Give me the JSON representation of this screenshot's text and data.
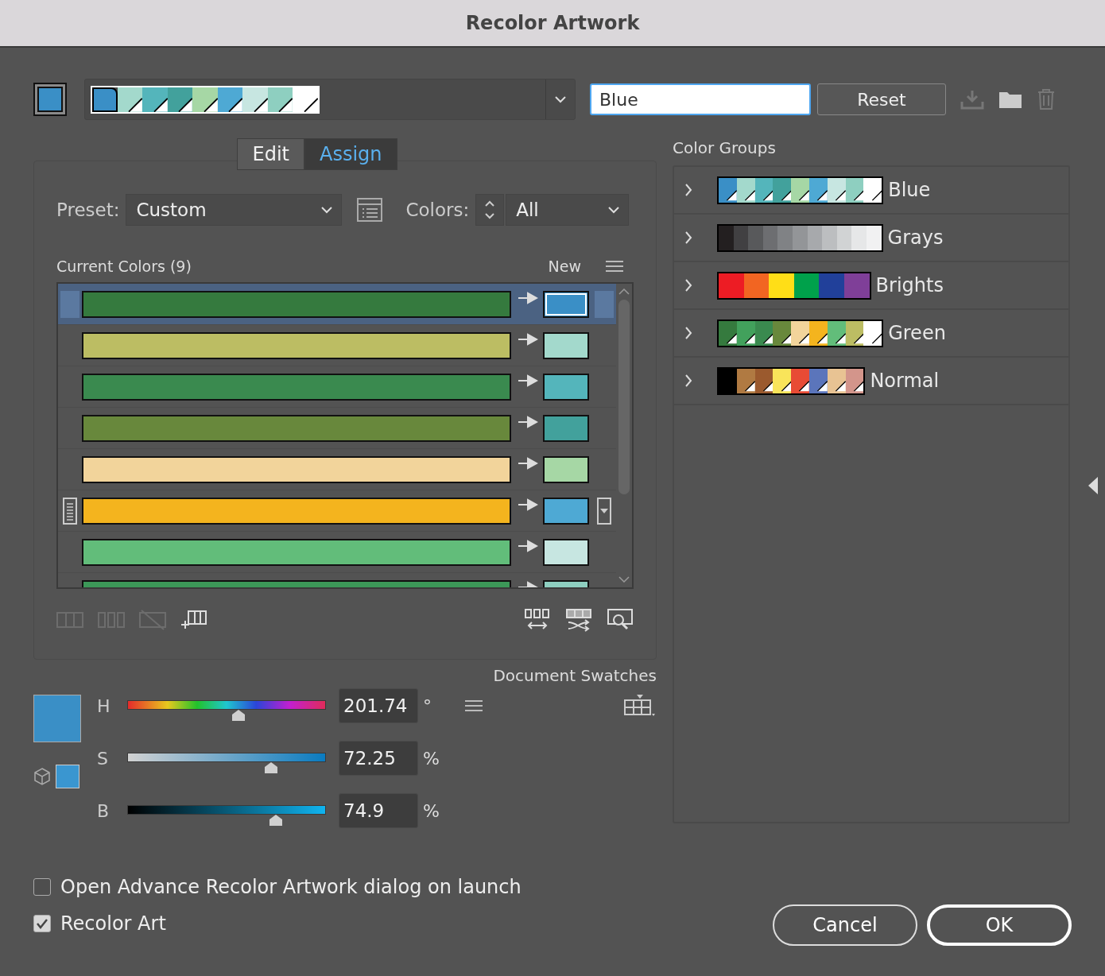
{
  "window": {
    "title": "Recolor Artwork"
  },
  "active_color": {
    "color": "#3a8fc6"
  },
  "group_strip": [
    {
      "color": "#3a8fc6",
      "global": false,
      "selected": true
    },
    {
      "color": "#a3d9cc",
      "global": true,
      "selected": false
    },
    {
      "color": "#54b5bb",
      "global": true,
      "selected": false
    },
    {
      "color": "#42a19c",
      "global": true,
      "selected": false
    },
    {
      "color": "#a6d7a5",
      "global": true,
      "selected": false
    },
    {
      "color": "#4ea9d4",
      "global": true,
      "selected": false
    },
    {
      "color": "#c7e6e1",
      "global": true,
      "selected": false
    },
    {
      "color": "#8ecfc0",
      "global": true,
      "selected": false
    },
    {
      "color": "#ffffff",
      "global": true,
      "selected": false
    }
  ],
  "name_field": {
    "value": "Blue"
  },
  "reset_button": "Reset",
  "tabs": [
    {
      "label": "Edit",
      "selected": false
    },
    {
      "label": "Assign",
      "selected": true
    }
  ],
  "preset": {
    "label": "Preset:",
    "value": "Custom"
  },
  "colors": {
    "label": "Colors:",
    "value": "All"
  },
  "current_colors": {
    "title": "Current Colors (9)",
    "new_label": "New",
    "rows": [
      {
        "current": {
          "color": "#357a3e"
        },
        "new": {
          "color": "#3a8fc6"
        },
        "selected": true,
        "hovered": false
      },
      {
        "current": {
          "color": "#bcbd63"
        },
        "new": {
          "color": "#a3d9cc"
        },
        "selected": false,
        "hovered": false
      },
      {
        "current": {
          "color": "#3a8a4f"
        },
        "new": {
          "color": "#54b5bb"
        },
        "selected": false,
        "hovered": false
      },
      {
        "current": {
          "color": "#68883c"
        },
        "new": {
          "color": "#42a19c"
        },
        "selected": false,
        "hovered": false
      },
      {
        "current": {
          "color": "#f2d49b"
        },
        "new": {
          "color": "#a6d7a5"
        },
        "selected": false,
        "hovered": false
      },
      {
        "current": {
          "color": "#f4b41e"
        },
        "new": {
          "color": "#4ea9d4"
        },
        "selected": false,
        "hovered": true
      },
      {
        "current": {
          "color": "#62bd7a"
        },
        "new": {
          "color": "#c7e6e1"
        },
        "selected": false,
        "hovered": false
      },
      {
        "current": {
          "color": "#3c9858"
        },
        "new": {
          "color": "#8ecfc0"
        },
        "selected": false,
        "hovered": false
      }
    ]
  },
  "document_swatches": "Document Swatches",
  "editor_color": {
    "color": "#3a8fc6"
  },
  "sliders": [
    {
      "kind": "hue",
      "label": "H",
      "level": 0.5604,
      "reading": "201.74",
      "unit": "°"
    },
    {
      "kind": "saturation",
      "label": "S",
      "level": 0.7225,
      "reading": "72.25",
      "unit": "%"
    },
    {
      "kind": "brightness",
      "label": "B",
      "level": 0.749,
      "reading": "74.9",
      "unit": "%"
    }
  ],
  "color_groups": {
    "title": "Color Groups",
    "groups": [
      {
        "name": "Blue",
        "expanded": false,
        "swatches": [
          {
            "color": "#3a8fc6",
            "global": true
          },
          {
            "color": "#a3d9cc",
            "global": true
          },
          {
            "color": "#54b5bb",
            "global": true
          },
          {
            "color": "#42a19c",
            "global": true
          },
          {
            "color": "#a6d7a5",
            "global": true
          },
          {
            "color": "#4ea9d4",
            "global": true
          },
          {
            "color": "#c7e6e1",
            "global": true
          },
          {
            "color": "#8ecfc0",
            "global": true
          },
          {
            "color": "#ffffff",
            "global": true
          }
        ]
      },
      {
        "name": "Grays",
        "expanded": false,
        "swatches": [
          {
            "color": "#231f20",
            "global": false
          },
          {
            "color": "#414042",
            "global": false
          },
          {
            "color": "#58595b",
            "global": false
          },
          {
            "color": "#6d6e71",
            "global": false
          },
          {
            "color": "#808285",
            "global": false
          },
          {
            "color": "#939598",
            "global": false
          },
          {
            "color": "#a7a9ac",
            "global": false
          },
          {
            "color": "#bcbec0",
            "global": false
          },
          {
            "color": "#d1d3d4",
            "global": false
          },
          {
            "color": "#e6e7e8",
            "global": false
          },
          {
            "color": "#f1f1f2",
            "global": false
          }
        ]
      },
      {
        "name": "Brights",
        "expanded": false,
        "swatches": [
          {
            "color": "#ed1c24",
            "global": false
          },
          {
            "color": "#f26522",
            "global": false
          },
          {
            "color": "#ffde17",
            "global": false
          },
          {
            "color": "#00a14b",
            "global": false
          },
          {
            "color": "#21409a",
            "global": false
          },
          {
            "color": "#7f3f98",
            "global": false
          }
        ]
      },
      {
        "name": "Green",
        "expanded": false,
        "swatches": [
          {
            "color": "#357a3e",
            "global": true
          },
          {
            "color": "#42a15c",
            "global": true
          },
          {
            "color": "#3a8a4f",
            "global": true
          },
          {
            "color": "#68883c",
            "global": true
          },
          {
            "color": "#f2d49b",
            "global": true
          },
          {
            "color": "#f4b41e",
            "global": true
          },
          {
            "color": "#62bd7a",
            "global": true
          },
          {
            "color": "#bcbd63",
            "global": true
          },
          {
            "color": "#ffffff",
            "global": true
          }
        ]
      },
      {
        "name": "Normal",
        "expanded": false,
        "swatches": [
          {
            "color": "#000000",
            "global": false
          },
          {
            "color": "#b07a42",
            "global": true
          },
          {
            "color": "#9b5a2e",
            "global": true
          },
          {
            "color": "#f9e45a",
            "global": true
          },
          {
            "color": "#e84b35",
            "global": true
          },
          {
            "color": "#5b75bb",
            "global": true
          },
          {
            "color": "#e8c393",
            "global": true
          },
          {
            "color": "#d3958b",
            "global": true
          }
        ]
      }
    ]
  },
  "options": [
    {
      "label": "Open Advance Recolor Artwork dialog on launch",
      "checked": false
    },
    {
      "label": "Recolor Art",
      "checked": true
    }
  ],
  "buttons": [
    {
      "label": "Cancel",
      "default": false
    },
    {
      "label": "OK",
      "default": true
    }
  ]
}
